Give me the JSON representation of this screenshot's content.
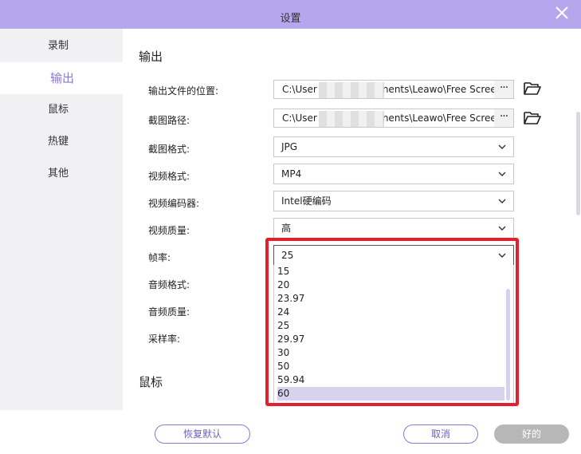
{
  "window": {
    "title": "设置"
  },
  "sidebar": {
    "items": [
      {
        "label": "录制"
      },
      {
        "label": "输出"
      },
      {
        "label": "鼠标"
      },
      {
        "label": "热键"
      },
      {
        "label": "其他"
      }
    ]
  },
  "output": {
    "section_title": "输出",
    "rows": {
      "output_location": {
        "label": "输出文件的位置:",
        "value_prefix": "C:\\User",
        "value_suffix": "nents\\Leawo\\Free Scree"
      },
      "screenshot_path": {
        "label": "截图路径:",
        "value_prefix": "C:\\User",
        "value_suffix": "nents\\Leawo\\Free Scree"
      },
      "screenshot_format": {
        "label": "截图格式:",
        "value": "JPG"
      },
      "video_format": {
        "label": "视频格式:",
        "value": "MP4"
      },
      "video_encoder": {
        "label": "视频编码器:",
        "value": "Intel硬编码"
      },
      "video_quality": {
        "label": "视频质量:",
        "value": "高"
      },
      "frame_rate": {
        "label": "帧率:",
        "value": "25"
      },
      "audio_format": {
        "label": "音频格式:"
      },
      "audio_quality": {
        "label": "音频质量:"
      },
      "sample_rate": {
        "label": "采样率:"
      }
    },
    "more_label": "···",
    "frame_rate_options": [
      "15",
      "20",
      "23.97",
      "24",
      "25",
      "29.97",
      "30",
      "50",
      "59.94",
      "60"
    ],
    "highlighted_option": "60"
  },
  "mouse_section": {
    "title": "鼠标"
  },
  "footer": {
    "reset_label": "恢复默认",
    "cancel_label": "取消",
    "ok_label": "好的"
  },
  "colors": {
    "accent": "#b6a6ee",
    "active_text": "#8a78d6",
    "highlight_border": "#e4202c"
  }
}
